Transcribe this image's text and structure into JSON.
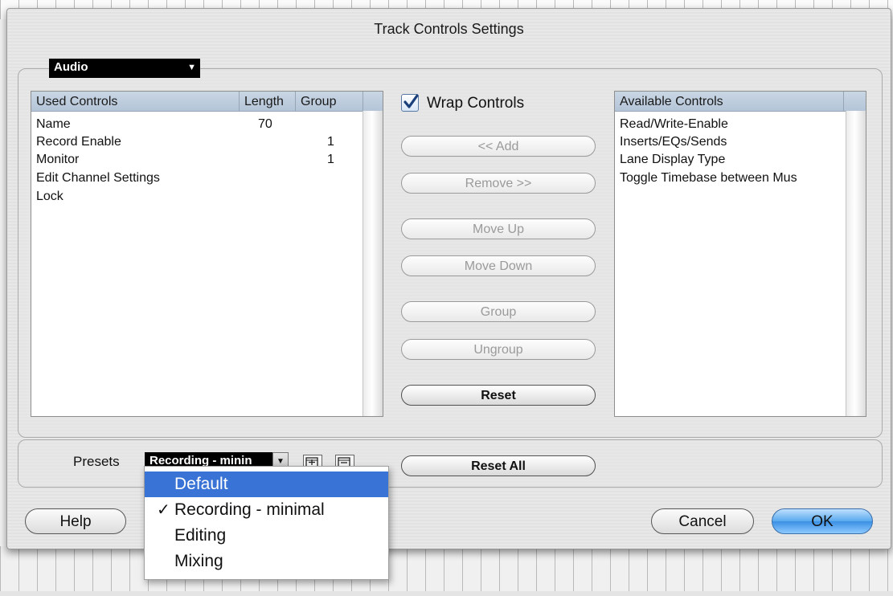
{
  "dialog": {
    "title": "Track Controls Settings"
  },
  "track_type": {
    "selected": "Audio"
  },
  "used_controls": {
    "headers": [
      "Used Controls",
      "Length",
      "Group"
    ],
    "rows": [
      {
        "name": "Name",
        "length": "70",
        "group": ""
      },
      {
        "name": "Record Enable",
        "length": "",
        "group": "1"
      },
      {
        "name": "Monitor",
        "length": "",
        "group": "1"
      },
      {
        "name": "Edit Channel Settings",
        "length": "",
        "group": ""
      },
      {
        "name": "Lock",
        "length": "",
        "group": ""
      }
    ]
  },
  "wrap_controls": {
    "label": "Wrap Controls",
    "checked": true
  },
  "actions": {
    "add": "<< Add",
    "remove": "Remove >>",
    "move_up": "Move Up",
    "move_down": "Move Down",
    "group": "Group",
    "ungroup": "Ungroup",
    "reset": "Reset"
  },
  "available_controls": {
    "header": "Available Controls",
    "items": [
      "Read/Write-Enable",
      "Inserts/EQs/Sends",
      "Lane Display Type",
      "Toggle Timebase between Mus"
    ]
  },
  "presets": {
    "label": "Presets",
    "selected": "Recording - minin",
    "reset_all": "Reset All",
    "menu": [
      {
        "label": "Default",
        "checked": false,
        "highlighted": true
      },
      {
        "label": "Recording - minimal",
        "checked": true,
        "highlighted": false
      },
      {
        "label": "Editing",
        "checked": false,
        "highlighted": false
      },
      {
        "label": "Mixing",
        "checked": false,
        "highlighted": false
      }
    ],
    "checkmark": "✓"
  },
  "footer": {
    "help": "Help",
    "cancel": "Cancel",
    "ok": "OK"
  },
  "colors": {
    "highlight": "#3a73d6",
    "ok_button": "#58a8ee",
    "header_bg": "#c9d6e4"
  }
}
